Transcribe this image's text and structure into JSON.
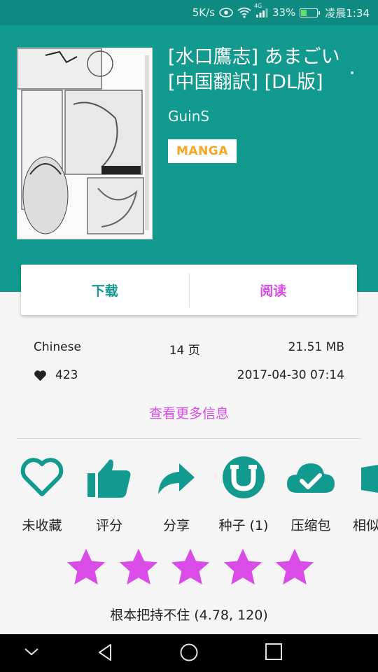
{
  "status_bar": {
    "speed": "5K/s",
    "network_tag": "4G",
    "battery_percent": "33%",
    "battery_level": 0.33,
    "time": "凌晨1:34"
  },
  "gallery": {
    "title": "[水口鷹志] あまごい [中国翻訳] [DL版]",
    "uploader": "GuinS",
    "category": "MANGA",
    "category_color": "#f5a623",
    "cover_icon": "manga-cover-image"
  },
  "actions": {
    "download": "下载",
    "read": "阅读",
    "download_color": "#139a8e",
    "read_color": "#d94ce8"
  },
  "info": {
    "language": "Chinese",
    "pages": "14 页",
    "size": "21.51 MB",
    "favorites": "423",
    "posted": "2017-04-30 07:14",
    "more_info": "查看更多信息"
  },
  "tools": [
    {
      "label": "未收藏",
      "icon": "heart-outline-icon"
    },
    {
      "label": "评分",
      "icon": "thumbs-up-icon"
    },
    {
      "label": "分享",
      "icon": "share-icon"
    },
    {
      "label": "种子 (1)",
      "icon": "torrent-icon"
    },
    {
      "label": "压缩包",
      "icon": "cloud-check-icon"
    },
    {
      "label": "相似",
      "icon": "similar-icon"
    }
  ],
  "rating": {
    "stars_filled": 5,
    "stars_total": 5,
    "text": "根本把持不住 (4.78, 120)",
    "star_color": "#d94ce8"
  },
  "colors": {
    "primary": "#139a8e",
    "primary_dark": "#0f8a80",
    "accent": "#d94ce8"
  }
}
